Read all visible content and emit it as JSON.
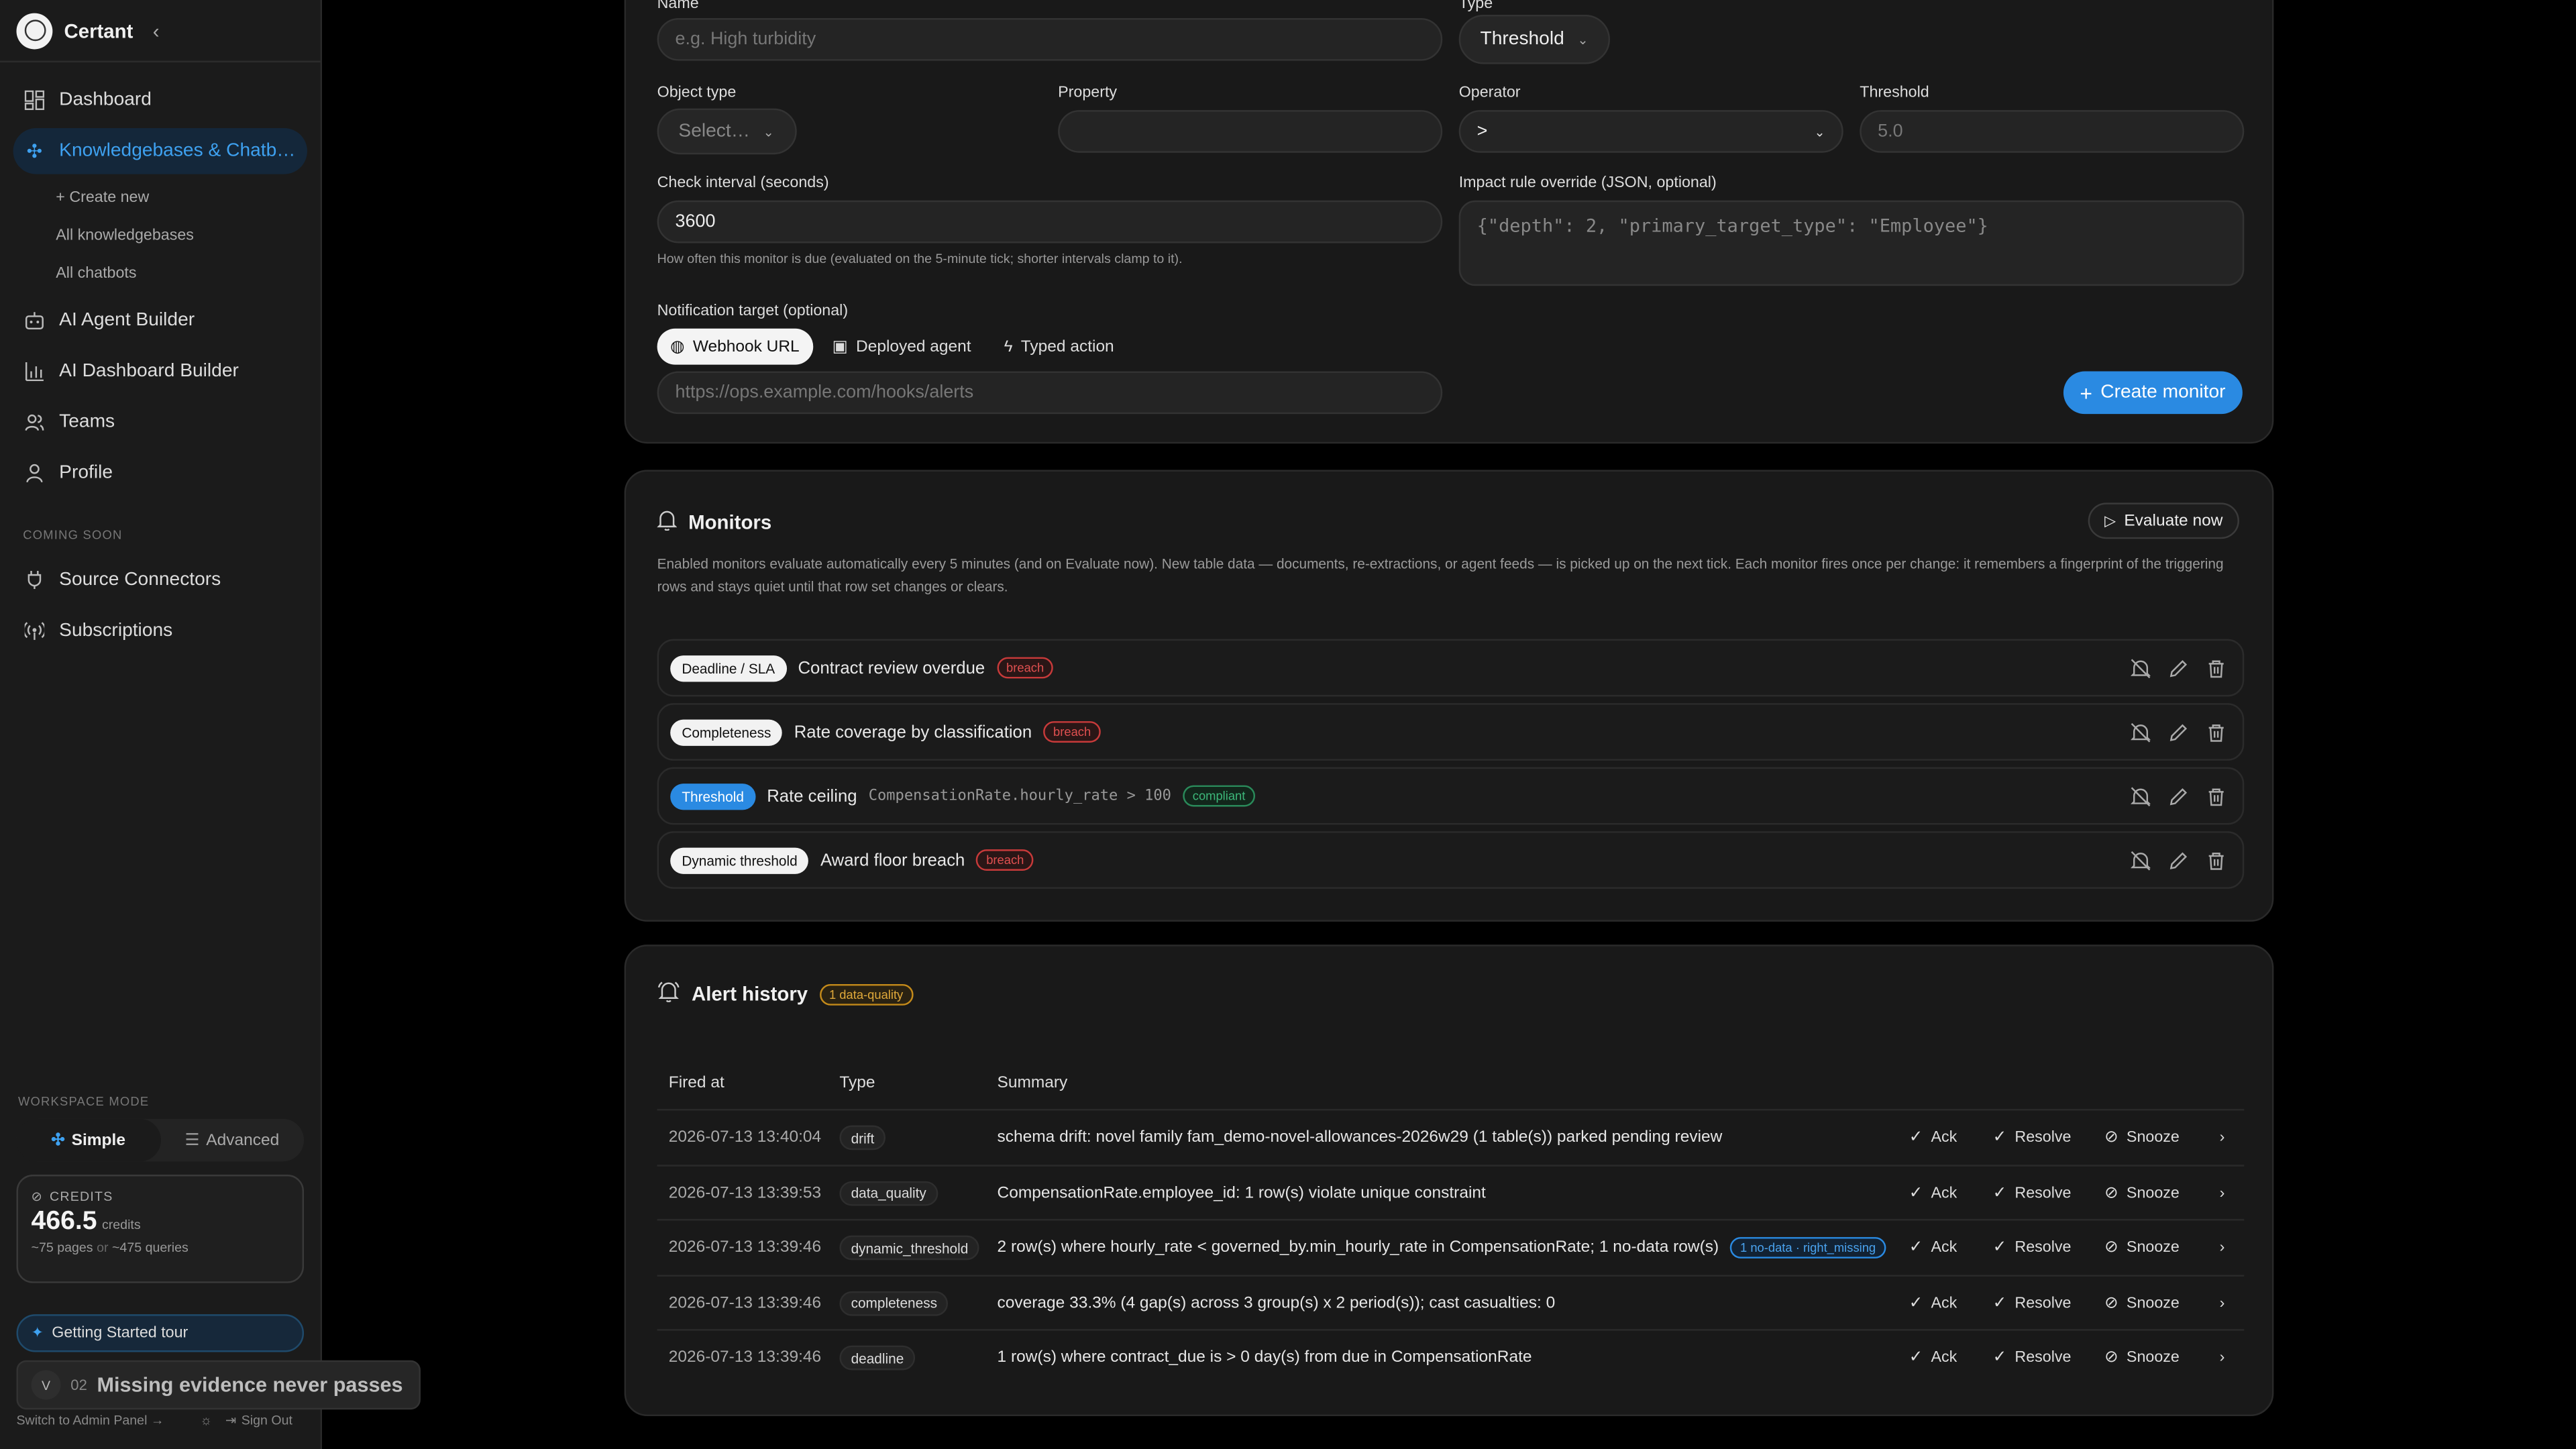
{
  "app": {
    "name": "Certant"
  },
  "sidebar": {
    "items": [
      {
        "label": "Dashboard",
        "icon": "dashboard-icon"
      },
      {
        "label": "Knowledgebases & Chatb…",
        "icon": "sparkle-icon",
        "active": true
      },
      {
        "label": "AI Agent Builder",
        "icon": "robot-icon"
      },
      {
        "label": "AI Dashboard Builder",
        "icon": "bar-chart-icon"
      },
      {
        "label": "Teams",
        "icon": "users-icon"
      },
      {
        "label": "Profile",
        "icon": "user-icon"
      }
    ],
    "subitems": [
      "+ Create new",
      "All knowledgebases",
      "All chatbots"
    ],
    "coming_soon_label": "COMING SOON",
    "coming_soon": [
      {
        "label": "Source Connectors",
        "icon": "plug-icon"
      },
      {
        "label": "Subscriptions",
        "icon": "broadcast-icon"
      }
    ],
    "workspace_mode_label": "WORKSPACE MODE",
    "mode_simple": "Simple",
    "mode_advanced": "Advanced",
    "credits_label": "CREDITS",
    "credits_amount": "466.5",
    "credits_unit": "credits",
    "credits_est_pages": "~75 pages",
    "credits_est_or": "or",
    "credits_est_queries": "~475 queries",
    "tour_label": "Getting Started tour",
    "avatar_initial": "V",
    "toast_step": "02",
    "toast_title": "Missing evidence never passes",
    "admin_link": "Switch to Admin Panel →",
    "sign_out": "Sign Out"
  },
  "form": {
    "name_label": "Name",
    "name_placeholder": "e.g. High turbidity",
    "type_label": "Type",
    "type_value": "Threshold",
    "object_type_label": "Object type",
    "object_type_value": "Select…",
    "property_label": "Property",
    "property_value": "",
    "operator_label": "Operator",
    "operator_value": ">",
    "threshold_label": "Threshold",
    "threshold_placeholder": "5.0",
    "interval_label": "Check interval (seconds)",
    "interval_value": "3600",
    "interval_hint": "How often this monitor is due (evaluated on the 5-minute tick; shorter intervals clamp to it).",
    "impact_label": "Impact rule override (JSON, optional)",
    "impact_placeholder": "{\"depth\": 2, \"primary_target_type\": \"Employee\"}",
    "notify_label": "Notification target (optional)",
    "notify_options": [
      "Webhook URL",
      "Deployed agent",
      "Typed action"
    ],
    "webhook_placeholder": "https://ops.example.com/hooks/alerts",
    "create_button": "Create monitor"
  },
  "monitors": {
    "title": "Monitors",
    "evaluate_button": "Evaluate now",
    "description": "Enabled monitors evaluate automatically every 5 minutes (and on Evaluate now). New table data — documents, re-extractions, or agent feeds — is picked up on the next tick. Each monitor fires once per change: it remembers a fingerprint of the triggering rows and stays quiet until that row set changes or clears.",
    "rows": [
      {
        "type": "Deadline / SLA",
        "name": "Contract review overdue",
        "expr": "",
        "status": "breach"
      },
      {
        "type": "Completeness",
        "name": "Rate coverage by classification",
        "expr": "",
        "status": "breach"
      },
      {
        "type": "Threshold",
        "name": "Rate ceiling",
        "expr": "CompensationRate.hourly_rate > 100",
        "status": "compliant"
      },
      {
        "type": "Dynamic threshold",
        "name": "Award floor breach",
        "expr": "",
        "status": "breach"
      }
    ]
  },
  "alerts": {
    "title": "Alert history",
    "badge": "1 data-quality",
    "columns": [
      "Fired at",
      "Type",
      "Summary"
    ],
    "actions": [
      "Ack",
      "Resolve",
      "Snooze"
    ],
    "rows": [
      {
        "time": "2026-07-13 13:40:04",
        "type": "drift",
        "summary": "schema drift: novel family fam_demo-novel-allowances-2026w29 (1 table(s)) parked pending review",
        "badge": ""
      },
      {
        "time": "2026-07-13 13:39:53",
        "type": "data_quality",
        "summary": "CompensationRate.employee_id: 1 row(s) violate unique constraint",
        "badge": ""
      },
      {
        "time": "2026-07-13 13:39:46",
        "type": "dynamic_threshold",
        "summary": "2 row(s) where hourly_rate < governed_by.min_hourly_rate in CompensationRate; 1 no-data row(s)",
        "badge": "1 no-data · right_missing"
      },
      {
        "time": "2026-07-13 13:39:46",
        "type": "completeness",
        "summary": "coverage 33.3% (4 gap(s) across 3 group(s) x 2 period(s)); cast casualties: 0",
        "badge": ""
      },
      {
        "time": "2026-07-13 13:39:46",
        "type": "deadline",
        "summary": "1 row(s) where contract_due is > 0 day(s) from due in CompensationRate",
        "badge": ""
      }
    ]
  }
}
